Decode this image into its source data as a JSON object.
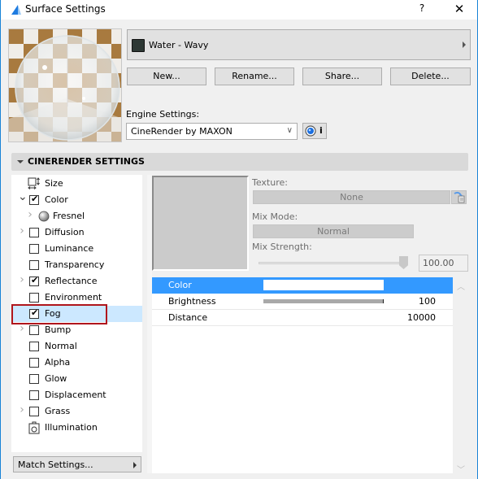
{
  "window": {
    "title": "Surface Settings",
    "help_label": "?",
    "close_label": "✕"
  },
  "material": {
    "name": "Water - Wavy",
    "swatch_color": "#2d3835"
  },
  "buttons": {
    "new": "New...",
    "rename": "Rename...",
    "share": "Share...",
    "delete": "Delete..."
  },
  "engine": {
    "label": "Engine Settings:",
    "value": "CineRender by MAXON",
    "chevron": "∨",
    "info_label": "i"
  },
  "section": {
    "title": "CINERENDER SETTINGS"
  },
  "channels": [
    {
      "label": "Size",
      "expander": "",
      "icon": "size",
      "checked": null
    },
    {
      "label": "Color",
      "expander": "open",
      "checked": true
    },
    {
      "label": "Fresnel",
      "expander": "closed",
      "icon": "sphere",
      "child": true,
      "checked": null
    },
    {
      "label": "Diffusion",
      "expander": "closed",
      "checked": false
    },
    {
      "label": "Luminance",
      "expander": "",
      "checked": false
    },
    {
      "label": "Transparency",
      "expander": "",
      "checked": false
    },
    {
      "label": "Reflectance",
      "expander": "closed",
      "checked": true
    },
    {
      "label": "Environment",
      "expander": "",
      "checked": false
    },
    {
      "label": "Fog",
      "expander": "",
      "checked": true,
      "selected": true
    },
    {
      "label": "Bump",
      "expander": "closed",
      "checked": false
    },
    {
      "label": "Normal",
      "expander": "",
      "checked": false
    },
    {
      "label": "Alpha",
      "expander": "",
      "checked": false
    },
    {
      "label": "Glow",
      "expander": "",
      "checked": false
    },
    {
      "label": "Displacement",
      "expander": "",
      "checked": false
    },
    {
      "label": "Grass",
      "expander": "closed",
      "checked": false
    },
    {
      "label": "Illumination",
      "expander": "",
      "icon": "illumination",
      "checked": null
    }
  ],
  "match_settings": "Match Settings...",
  "texture": {
    "label": "Texture:",
    "value": "None",
    "mix_mode_label": "Mix Mode:",
    "mix_mode_value": "Normal",
    "mix_strength_label": "Mix Strength:",
    "mix_strength_value": "100.00",
    "mix_strength_percent": 100
  },
  "params": [
    {
      "name": "Color",
      "type": "color",
      "color": "#ffffff",
      "value": ""
    },
    {
      "name": "Brightness",
      "type": "bar",
      "percent": 100,
      "value": "100"
    },
    {
      "name": "Distance",
      "type": "number",
      "value": "10000"
    }
  ],
  "colors": {
    "accent": "#3399ff",
    "selection": "#cce8ff",
    "highlight_box": "#b0151c",
    "window_border": "#1883d7"
  }
}
